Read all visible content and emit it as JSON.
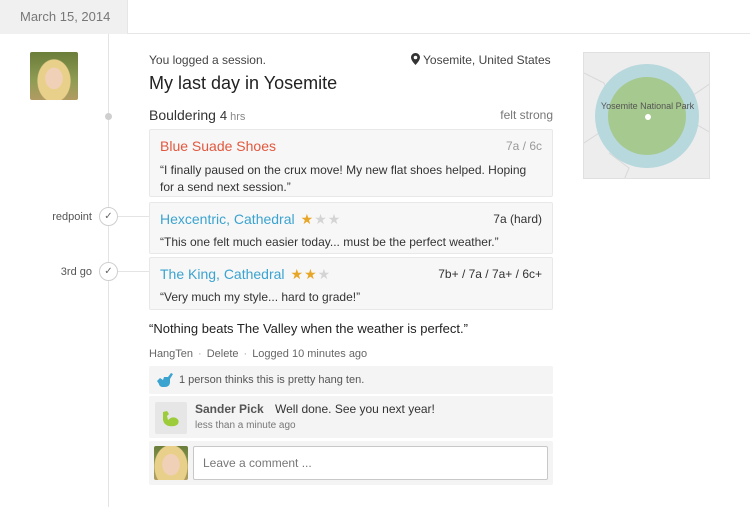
{
  "date_header": {
    "label": "March 15, 2014"
  },
  "session": {
    "meta": "You logged a session.",
    "location": "Yosemite, United States",
    "title": "My last day in Yosemite",
    "activity": {
      "name": "Bouldering",
      "hours": "4",
      "hours_unit": "hrs",
      "feeling": "felt strong"
    }
  },
  "climbs": [
    {
      "name": "Blue Suade Shoes",
      "grade": "7a / 6c",
      "note": "“I finally paused on the crux move! My new flat shoes helped. Hoping for a send next session.”",
      "marker": ""
    },
    {
      "name": "Hexcentric, Cathedral",
      "rating": 1,
      "max_rating": 3,
      "grade": "7a (hard)",
      "note": "“This one felt much easier today... must be the perfect weather.”",
      "marker": "redpoint"
    },
    {
      "name": "The King, Cathedral",
      "rating": 2,
      "max_rating": 3,
      "grade": "7b+ / 7a / 7a+ / 6c+",
      "note": "“Very much my style... hard to grade!”",
      "marker": "3rd go"
    }
  ],
  "quote": "“Nothing beats The Valley when the weather is perfect.”",
  "actions": {
    "hangten": "HangTen",
    "delete": "Delete",
    "logged": "Logged 10 minutes ago"
  },
  "hang_ten": {
    "text": "1 person thinks this is pretty hang ten."
  },
  "comment": {
    "author": "Sander Pick",
    "text": "Well done. See you next year!",
    "time": "less than a minute ago"
  },
  "compose": {
    "placeholder": "Leave a comment ..."
  },
  "map": {
    "label": "Yosemite National Park"
  },
  "colors": {
    "red_link": "#e2583e",
    "blue_link": "#3ba3d0",
    "star": "#e8a628",
    "hang_icon": "#3ba3d0",
    "muscle_icon": "#9ccc3a"
  }
}
